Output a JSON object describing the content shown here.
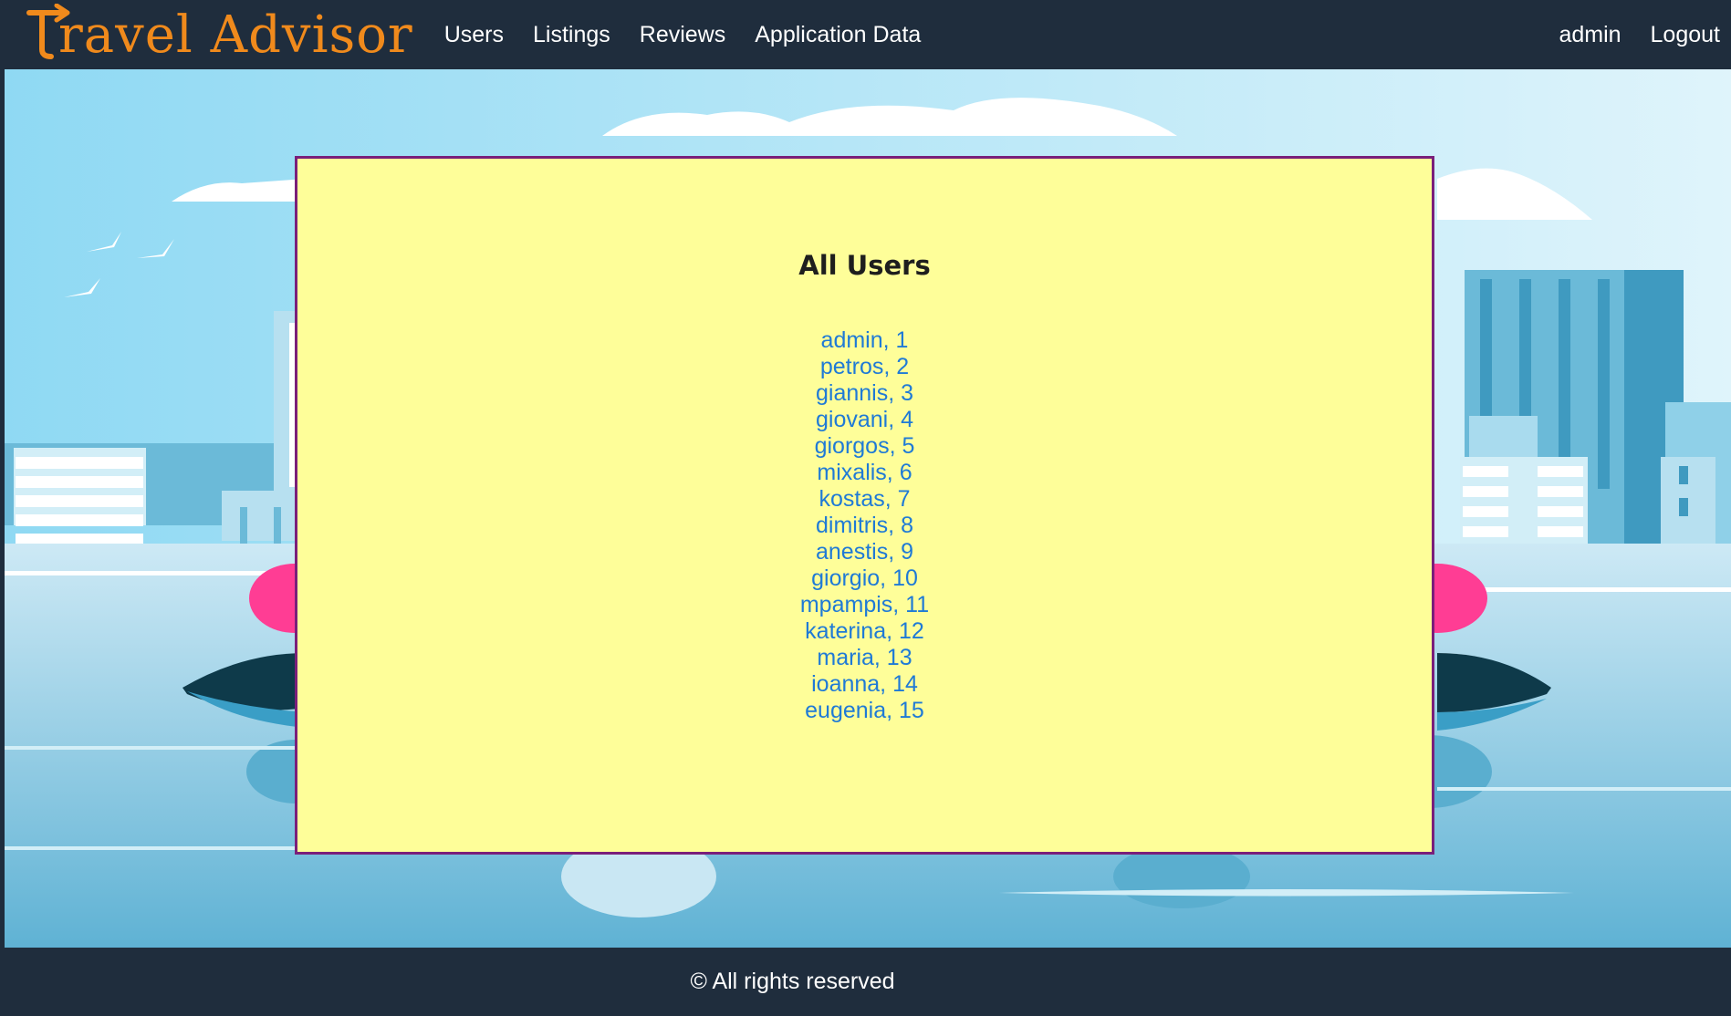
{
  "brand": {
    "name": "Travel Advisor",
    "logo_text": "ravel Advisor",
    "color": "#f08a1c"
  },
  "nav": {
    "links": [
      {
        "label": "Users"
      },
      {
        "label": "Listings"
      },
      {
        "label": "Reviews"
      },
      {
        "label": "Application Data"
      }
    ],
    "right": {
      "user": "admin",
      "logout": "Logout"
    }
  },
  "main": {
    "title": "All Users",
    "users": [
      "admin, 1",
      "petros, 2",
      "giannis, 3",
      "giovani, 4",
      "giorgos, 5",
      "mixalis, 6",
      "kostas, 7",
      "dimitris, 8",
      "anestis, 9",
      "giorgio, 10",
      "mpampis, 11",
      "katerina, 12",
      "maria, 13",
      "ioanna, 14",
      "eugenia, 15"
    ]
  },
  "footer": {
    "text": "© All rights reserved"
  },
  "colors": {
    "navbar": "#1f2d3d",
    "card": "#fefe99",
    "card_border": "#7a1f7a",
    "link": "#1f7ad6"
  }
}
